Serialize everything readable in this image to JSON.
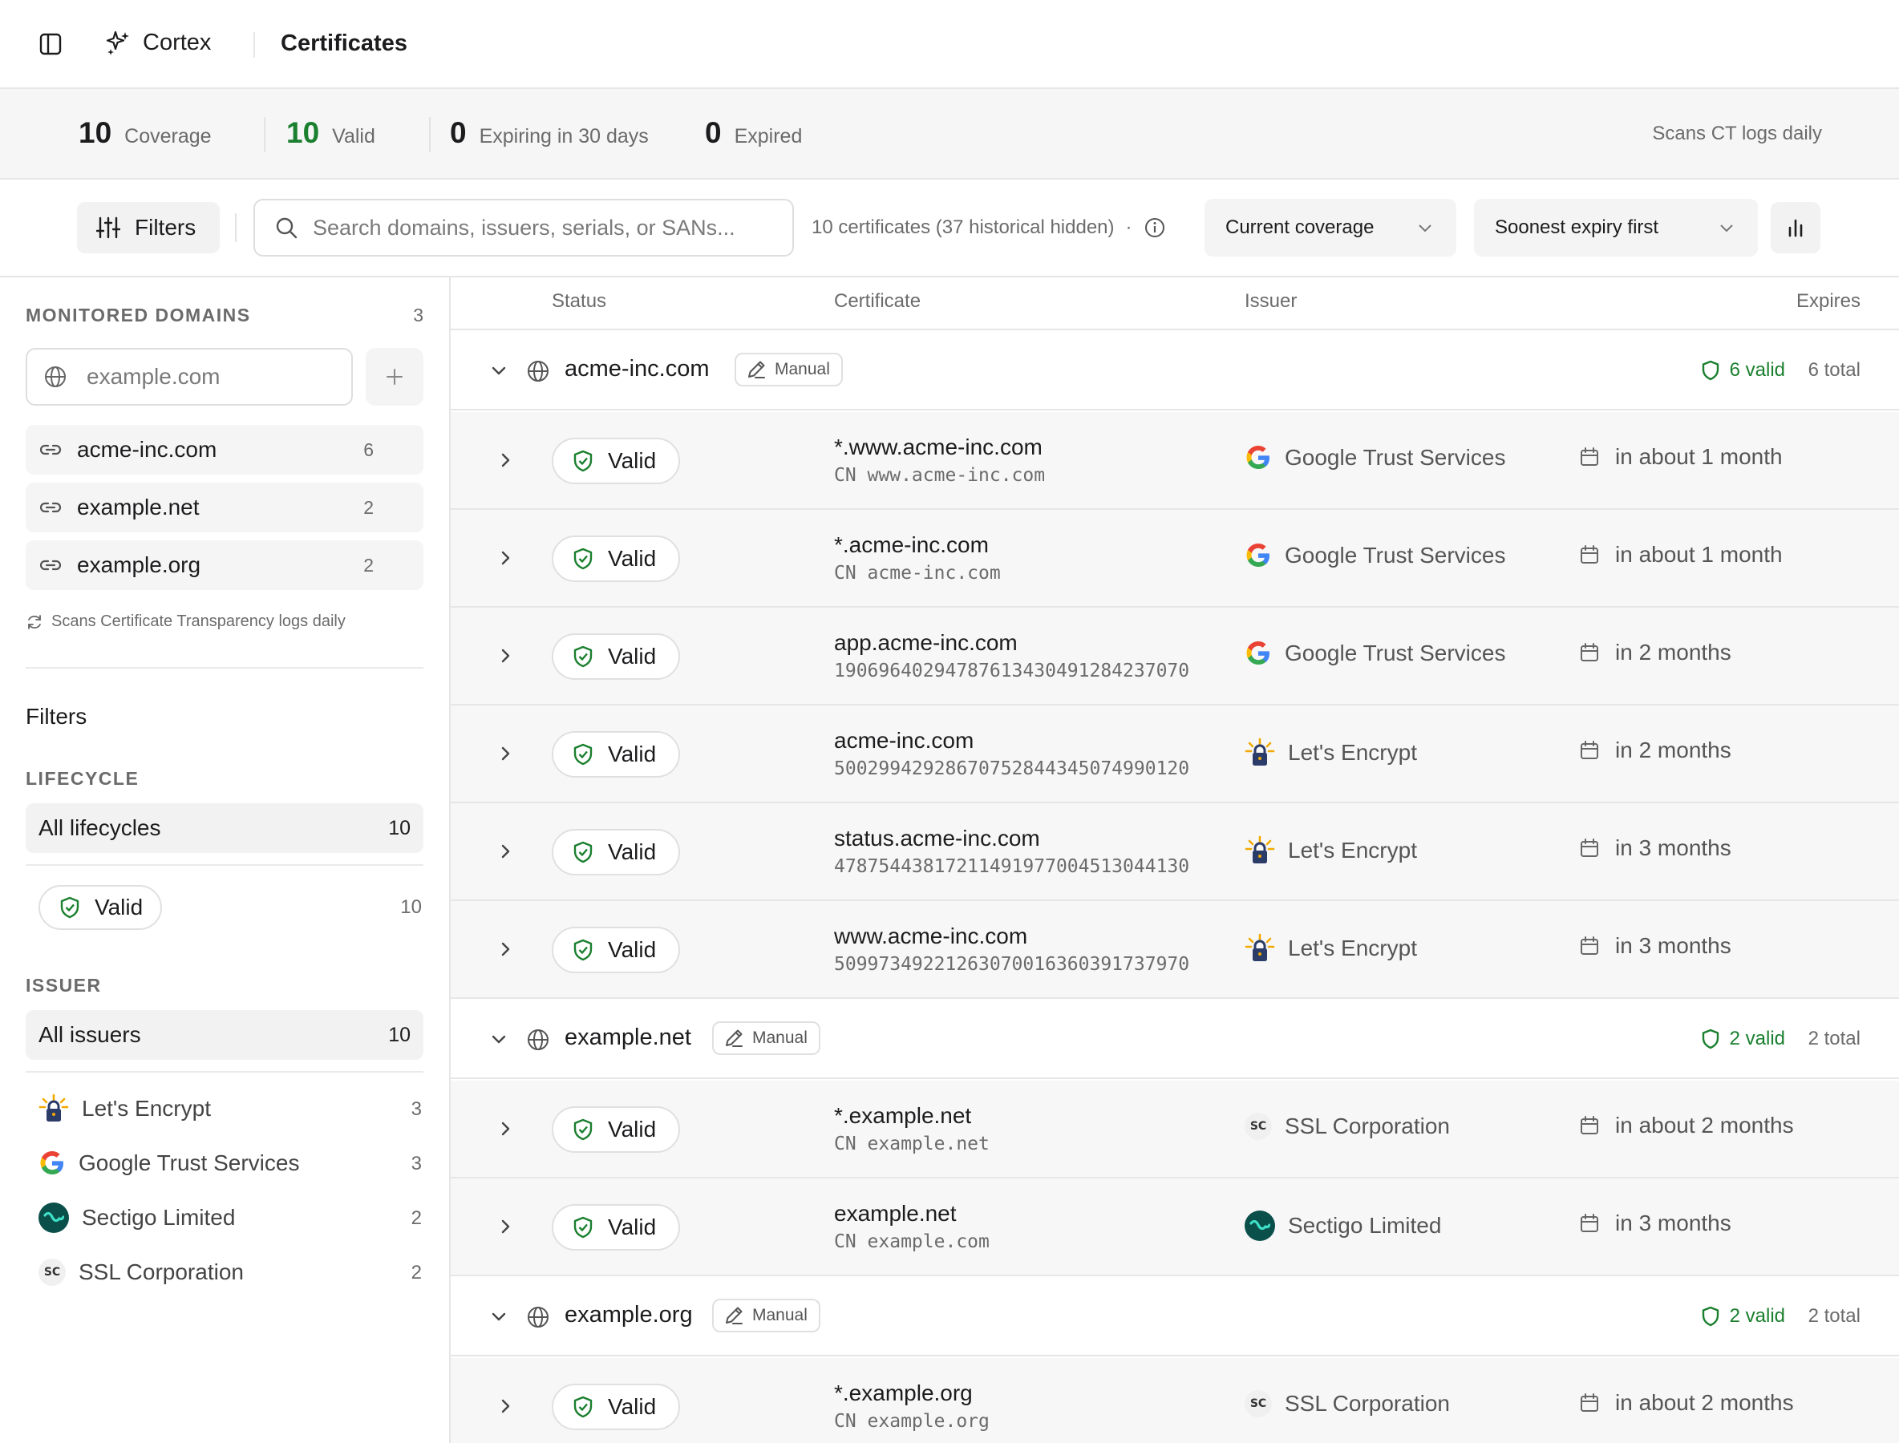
{
  "app": {
    "name": "Cortex",
    "page_title": "Certificates"
  },
  "stats": [
    {
      "value": "10",
      "label": "Coverage"
    },
    {
      "value": "10",
      "label": "Valid"
    },
    {
      "value": "0",
      "label": "Expiring in 30 days"
    },
    {
      "value": "0",
      "label": "Expired"
    }
  ],
  "stats_note": "Scans CT logs daily",
  "toolbar": {
    "filters_label": "Filters",
    "search_placeholder": "Search domains, issuers, serials, or SANs...",
    "count_text": "10 certificates (37 historical hidden)",
    "separator": "·",
    "coverage_select": "Current coverage",
    "sort_select": "Soonest expiry first"
  },
  "sidebar": {
    "monitored_title": "MONITORED DOMAINS",
    "monitored_count": "3",
    "domain_placeholder": "example.com",
    "domains": [
      {
        "name": "acme-inc.com",
        "count": "6"
      },
      {
        "name": "example.net",
        "count": "2"
      },
      {
        "name": "example.org",
        "count": "2"
      }
    ],
    "scan_note": "Scans Certificate Transparency logs daily",
    "filters_title": "Filters",
    "lifecycle_title": "LIFECYCLE",
    "all_lifecycles": {
      "label": "All lifecycles",
      "count": "10"
    },
    "valid_filter": {
      "label": "Valid",
      "count": "10"
    },
    "issuer_title": "ISSUER",
    "all_issuers": {
      "label": "All issuers",
      "count": "10"
    },
    "issuers": [
      {
        "name": "Let's Encrypt",
        "count": "3",
        "icon": "letsencrypt-icon"
      },
      {
        "name": "Google Trust Services",
        "count": "3",
        "icon": "google-icon"
      },
      {
        "name": "Sectigo Limited",
        "count": "2",
        "icon": "sectigo-icon"
      },
      {
        "name": "SSL Corporation",
        "count": "2",
        "icon": "sc-icon",
        "badge": "SC"
      }
    ]
  },
  "table": {
    "headers": {
      "status": "Status",
      "certificate": "Certificate",
      "issuer": "Issuer",
      "expires": "Expires"
    },
    "groups": [
      {
        "name": "acme-inc.com",
        "tag": "Manual",
        "valid": "6 valid",
        "total": "6 total",
        "rows": [
          {
            "status": "Valid",
            "name": "*.www.acme-inc.com",
            "sub": "CN www.acme-inc.com",
            "issuer": "Google Trust Services",
            "expires": "in about 1 month"
          },
          {
            "status": "Valid",
            "name": "*.acme-inc.com",
            "sub": "CN acme-inc.com",
            "issuer": "Google Trust Services",
            "expires": "in about 1 month"
          },
          {
            "status": "Valid",
            "name": "app.acme-inc.com",
            "sub": "19069640294787613430491284237070",
            "issuer": "Google Trust Services",
            "expires": "in 2 months"
          },
          {
            "status": "Valid",
            "name": "acme-inc.com",
            "sub": "50029942928670752844345074990120",
            "issuer": "Let's Encrypt",
            "expires": "in 2 months"
          },
          {
            "status": "Valid",
            "name": "status.acme-inc.com",
            "sub": "47875443817211491977004513044130",
            "issuer": "Let's Encrypt",
            "expires": "in 3 months"
          },
          {
            "status": "Valid",
            "name": "www.acme-inc.com",
            "sub": "50997349221263070016360391737970",
            "issuer": "Let's Encrypt",
            "expires": "in 3 months"
          }
        ]
      },
      {
        "name": "example.net",
        "tag": "Manual",
        "valid": "2 valid",
        "total": "2 total",
        "rows": [
          {
            "status": "Valid",
            "name": "*.example.net",
            "sub": "CN example.net",
            "issuer": "SSL Corporation",
            "expires": "in about 2 months"
          },
          {
            "status": "Valid",
            "name": "example.net",
            "sub": "CN example.com",
            "issuer": "Sectigo Limited",
            "expires": "in 3 months"
          }
        ]
      },
      {
        "name": "example.org",
        "tag": "Manual",
        "valid": "2 valid",
        "total": "2 total",
        "rows": [
          {
            "status": "Valid",
            "name": "*.example.org",
            "sub": "CN example.org",
            "issuer": "SSL Corporation",
            "expires": "in about 2 months"
          }
        ]
      }
    ]
  },
  "colors": {
    "accent_green": "#1a7f2e",
    "text": "#1c1c1e",
    "muted": "#6b6b6b",
    "border": "#e6e6e6"
  }
}
